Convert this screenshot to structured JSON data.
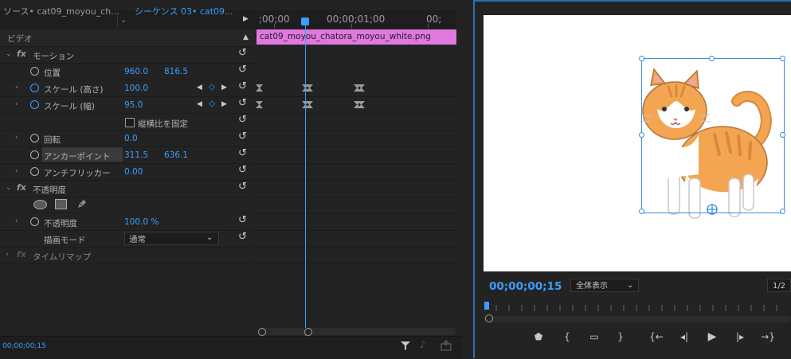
{
  "effect_controls": {
    "tabs": {
      "source": "ソース• cat09_moyou_ch...",
      "sequence": "シーケンス  03• cat09..."
    },
    "section_video": "ビデオ",
    "timeline_ruler": {
      "t0": ";00;00",
      "t1": "00;00;01;00"
    },
    "clip_name": "cat09_moyou_chatora_moyou_white.png",
    "motion": {
      "label": "モーション",
      "position": {
        "label": "位置",
        "x": "960.0",
        "y": "816.5"
      },
      "scale_height": {
        "label": "スケール (高さ)",
        "value": "100.0"
      },
      "scale_width": {
        "label": "スケール (幅)",
        "value": "95.0"
      },
      "uniform_scale": "縦横比を固定",
      "rotation": {
        "label": "回転",
        "value": "0.0"
      },
      "anchor_point": {
        "label": "アンカーポイント",
        "x": "311.5",
        "y": "636.1"
      },
      "anti_flicker": {
        "label": "アンチフリッカー",
        "value": "0.00"
      }
    },
    "opacity": {
      "label": "不透明度",
      "value_label": "不透明度",
      "value": "100.0 %",
      "blend_mode_label": "描画モード",
      "blend_mode_value": "通常"
    },
    "time_remap": "タイムリマップ",
    "footer_timecode": "00;00;00;15"
  },
  "program_monitor": {
    "timecode": "00;00;00;15",
    "zoom": "全体表示",
    "resolution": "1/2"
  },
  "colors": {
    "accent": "#3d9cff",
    "clip": "#e078e0",
    "panel": "#232323"
  }
}
